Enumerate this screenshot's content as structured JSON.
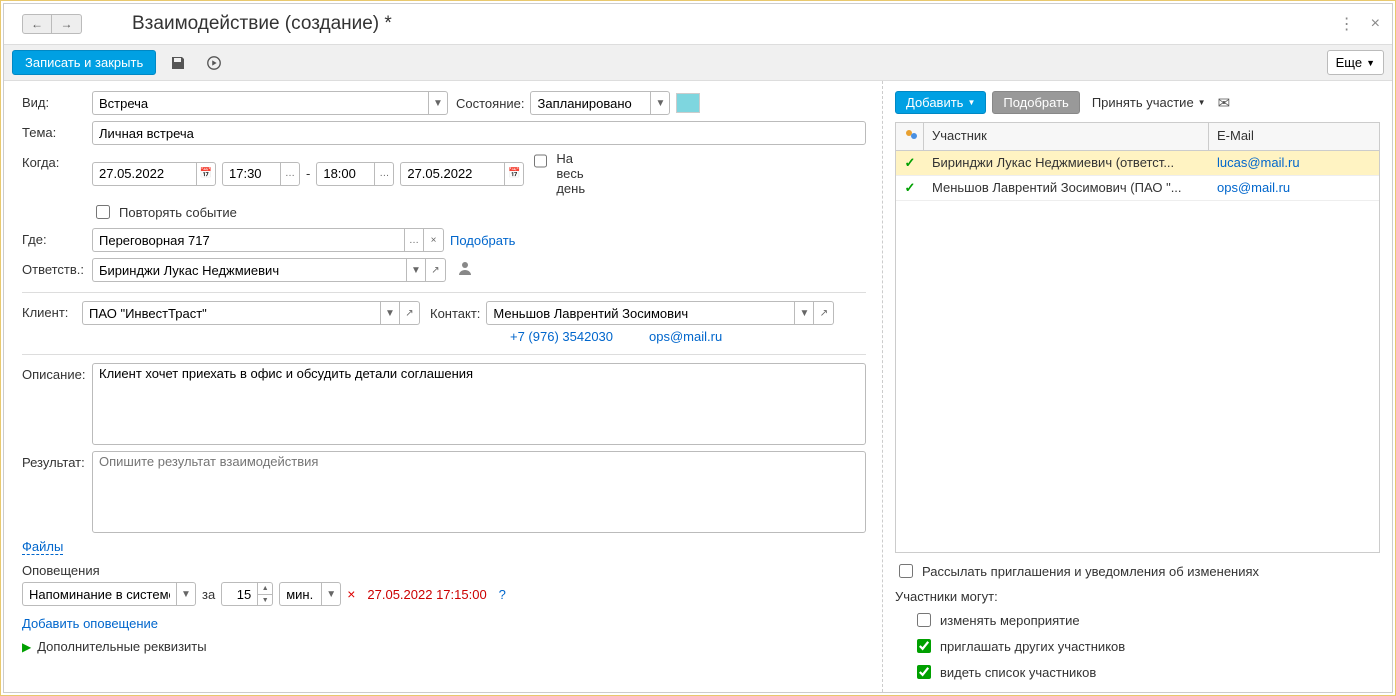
{
  "header": {
    "title": "Взаимодействие (создание) *"
  },
  "toolbar": {
    "save_close": "Записать и закрыть",
    "more": "Еще"
  },
  "labels": {
    "type": "Вид:",
    "state": "Состояние:",
    "subject": "Тема:",
    "when": "Когда:",
    "allday": "На весь день",
    "repeat": "Повторять событие",
    "where": "Где:",
    "select": "Подобрать",
    "responsible": "Ответств.:",
    "client": "Клиент:",
    "contact": "Контакт:",
    "description": "Описание:",
    "result": "Результат:",
    "files": "Файлы",
    "notifications": "Оповещения",
    "per": "за",
    "add_notification": "Добавить оповещение",
    "extra": "Дополнительные реквизиты"
  },
  "values": {
    "type": "Встреча",
    "state": "Запланировано",
    "subject": "Личная встреча",
    "date_start": "27.05.2022",
    "time_start": "17:30",
    "time_end": "18:00",
    "date_end": "27.05.2022",
    "where": "Переговорная 717",
    "responsible": "Биринджи Лукас Неджмиевич",
    "client": "ПАО \"ИнвестТраст\"",
    "contact": "Меньшов Лаврентий Зосимович",
    "contact_phone": "+7 (976) 3542030",
    "contact_email": "ops@mail.ru",
    "description": "Клиент хочет приехать в офис и обсудить детали соглашения",
    "result_placeholder": "Опишите результат взаимодействия",
    "notif_type": "Напоминание в системе",
    "notif_value": "15",
    "notif_unit": "мин.",
    "notif_time": "27.05.2022 17:15:00"
  },
  "right": {
    "add": "Добавить",
    "select": "Подобрать",
    "accept": "Принять участие",
    "col_participant": "Участник",
    "col_email": "E-Mail",
    "rows": [
      {
        "name": "Биринджи Лукас Неджмиевич  (ответст...",
        "email": "lucas@mail.ru",
        "selected": true
      },
      {
        "name": "Меньшов Лаврентий Зосимович (ПАО \"...",
        "email": "ops@mail.ru",
        "selected": false
      }
    ],
    "send_invites": "Рассылать приглашения и уведомления об изменениях",
    "can_label": "Участники могут:",
    "opt_modify": "изменять мероприятие",
    "opt_invite": "приглашать других участников",
    "opt_see": "видеть список участников"
  }
}
